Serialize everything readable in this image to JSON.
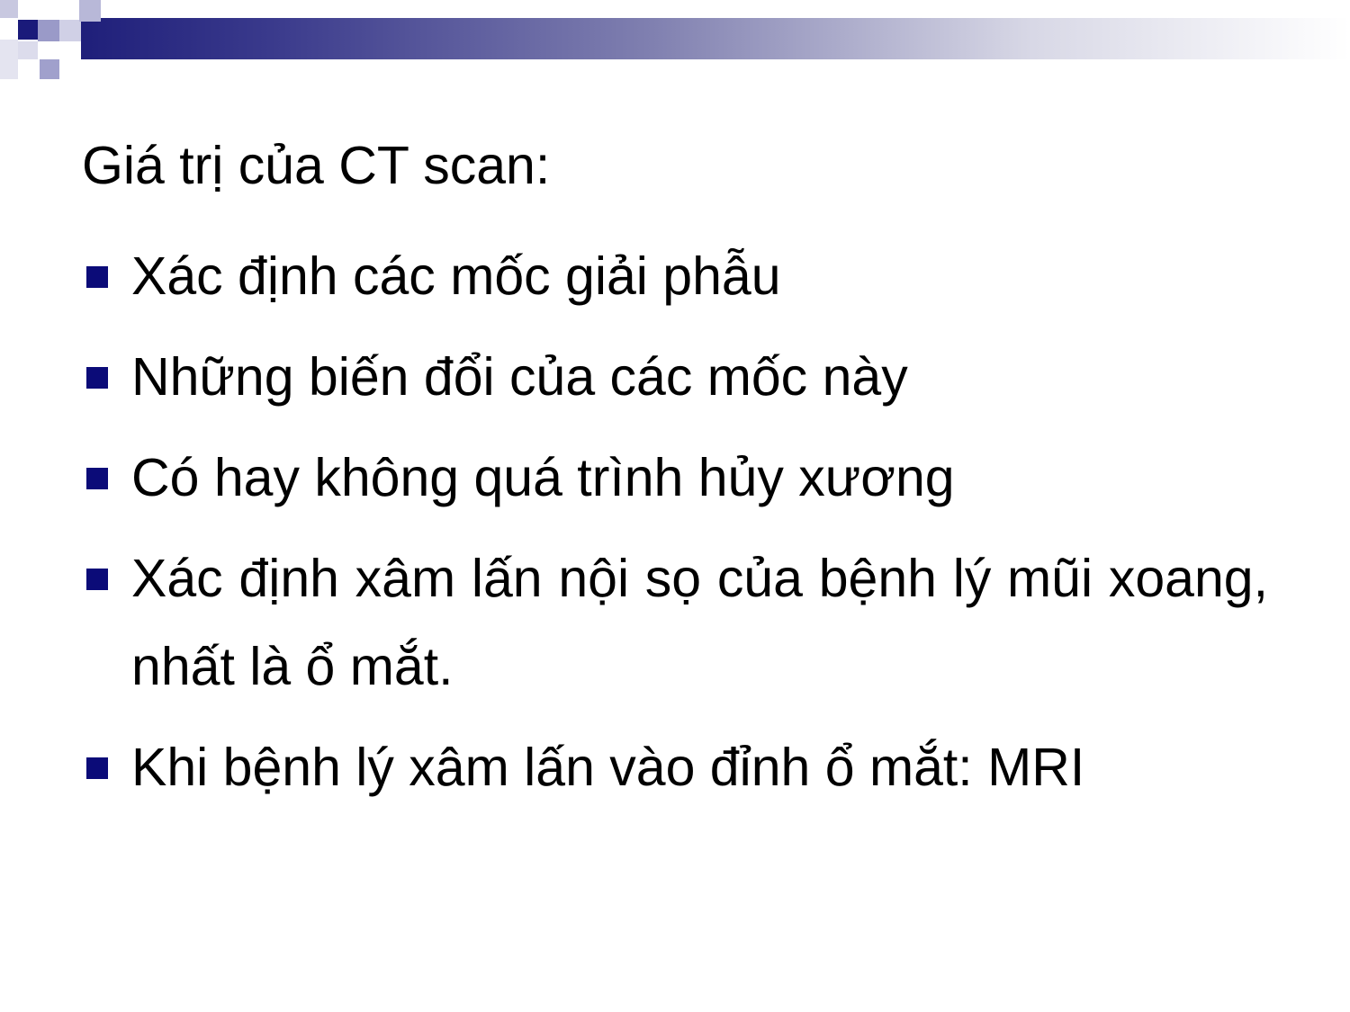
{
  "slide": {
    "title": "Giá trị của CT scan:",
    "bullets": [
      {
        "text": "Xác định các mốc giải phẫu"
      },
      {
        "text": "Những biến đổi của các mốc này"
      },
      {
        "text": "Có hay không quá trình hủy xương"
      },
      {
        "text": "Xác định xâm lấn nội sọ của bệnh lý mũi xoang, nhất là ổ mắt."
      },
      {
        "text": "Khi bệnh lý xâm lấn vào đỉnh ổ mắt: MRI"
      }
    ]
  },
  "colors": {
    "bullet": "#0b0b78",
    "header_dark": "#1f1f7a"
  }
}
